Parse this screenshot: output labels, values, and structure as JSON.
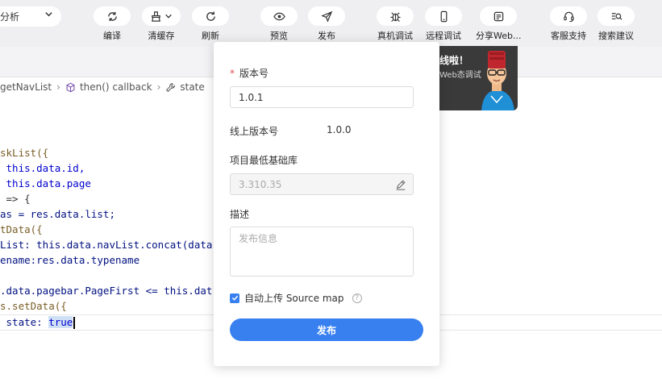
{
  "toolbar": {
    "mode_select": "分析",
    "buttons": [
      {
        "id": "compile",
        "label": "编译",
        "icon": "refresh-cycle-icon"
      },
      {
        "id": "clear-cache",
        "label": "清缓存",
        "icon": "broom-icon"
      },
      {
        "id": "refresh",
        "label": "刷新",
        "icon": "refresh-icon"
      },
      {
        "id": "preview",
        "label": "预览",
        "icon": "eye-icon"
      },
      {
        "id": "publish",
        "label": "发布",
        "icon": "paper-plane-icon"
      },
      {
        "id": "device-debug",
        "label": "真机调试",
        "icon": "bug-icon"
      },
      {
        "id": "remote-debug",
        "label": "远程调试",
        "icon": "phone-icon"
      },
      {
        "id": "share-web",
        "label": "分享Web...",
        "icon": "share-doc-icon"
      },
      {
        "id": "support",
        "label": "客服支持",
        "icon": "headset-icon"
      },
      {
        "id": "search-advice",
        "label": "搜索建议",
        "icon": "search-list-icon"
      }
    ]
  },
  "breadcrumb": {
    "items": [
      "getNavList",
      "then() callback",
      "state"
    ]
  },
  "code": {
    "lines": [
      "skList({",
      " this.data.id,",
      " this.data.page",
      " => {",
      "as = res.data.list;",
      "tData({",
      "List: this.data.navList.concat(data",
      "ename:res.data.typename",
      ".data.pagebar.PageFirst <= this.dat",
      "s.setData({",
      " state: ",
      "true"
    ]
  },
  "promo": {
    "line1": "线啦！",
    "line2": "Web态调试"
  },
  "dialog": {
    "version_label": "版本号",
    "version_value": "1.0.1",
    "online_version_label": "线上版本号",
    "online_version_value": "1.0.0",
    "min_lib_label": "项目最低基础库",
    "min_lib_value": "3.310.35",
    "desc_label": "描述",
    "desc_placeholder": "发布信息",
    "sourcemap_label": "自动上传 Source map",
    "publish_button": "发布",
    "accent_color": "#3880f0"
  }
}
